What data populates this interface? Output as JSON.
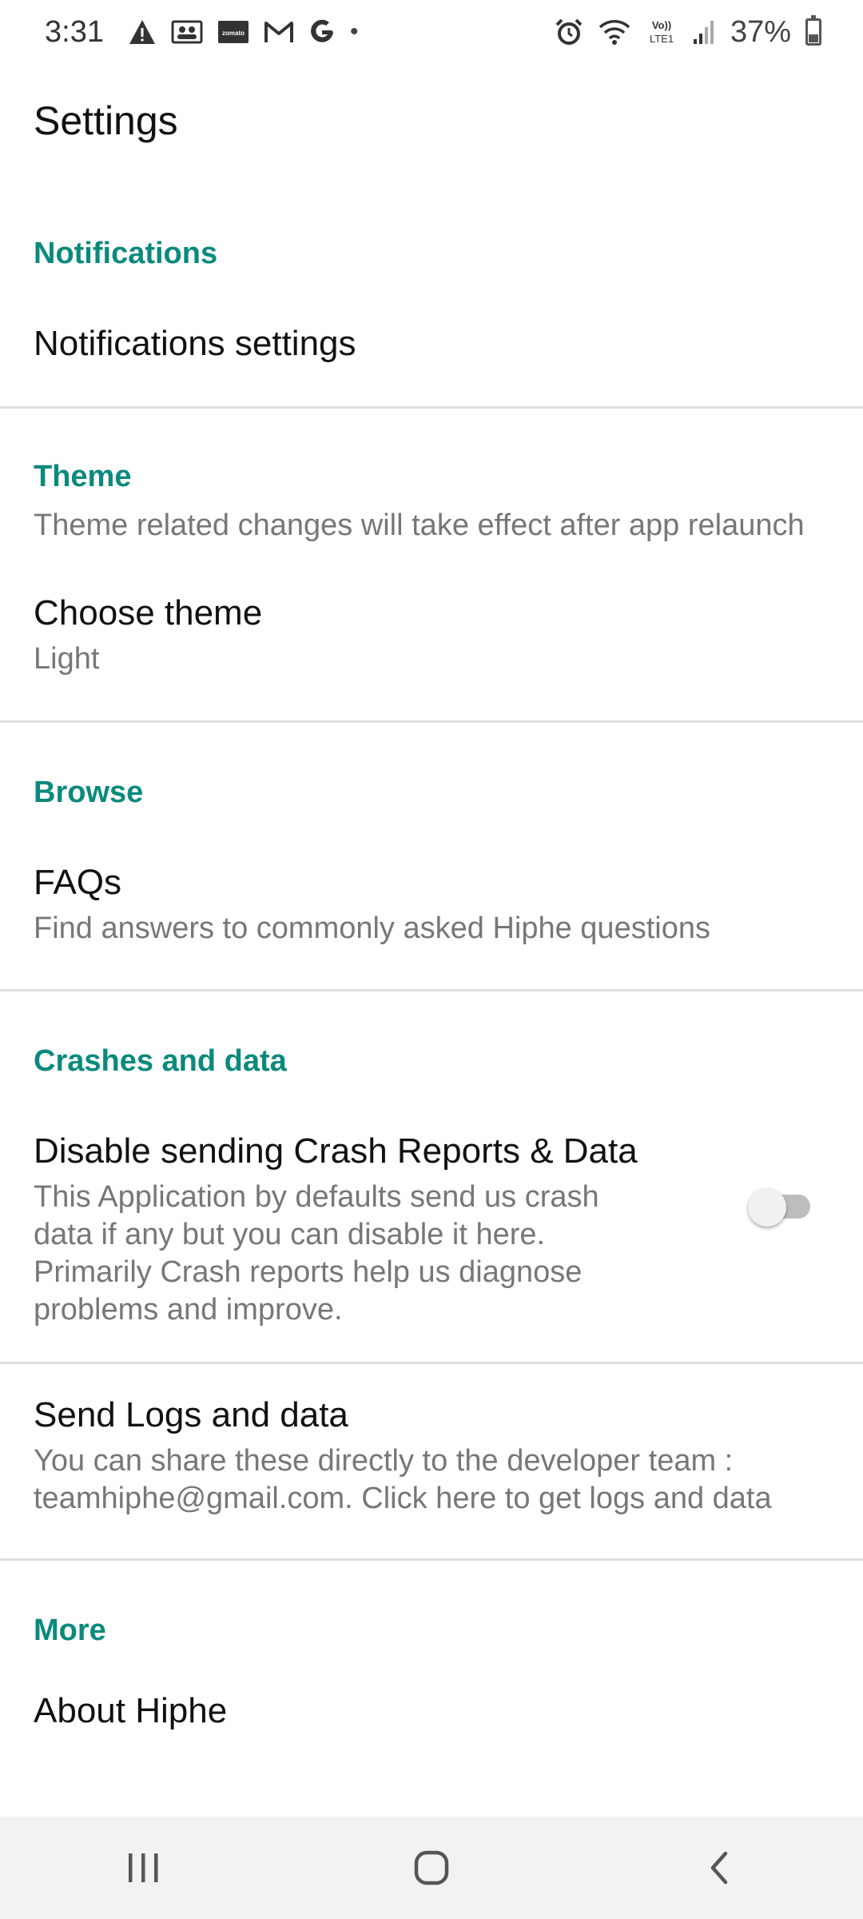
{
  "status_bar": {
    "time": "3:31",
    "battery_percent": "37%",
    "battery_level": 0.37,
    "left_icons": [
      "warning-icon",
      "contacts-icon",
      "zomato-icon",
      "gmail-icon",
      "google-icon",
      "more-dot"
    ],
    "right_icons": [
      "alarm-icon",
      "wifi-icon",
      "volte-icon",
      "signal-icon",
      "battery-icon"
    ],
    "volte_label": "Vo))\nLTE1",
    "zomato_label": "zomato"
  },
  "toolbar": {
    "title": "Settings"
  },
  "sections": {
    "notifications": {
      "header": "Notifications",
      "items": [
        {
          "title": "Notifications settings"
        }
      ]
    },
    "theme": {
      "header": "Theme",
      "header_summary": "Theme related changes will take effect after app relaunch",
      "items": [
        {
          "title": "Choose theme",
          "summary": "Light"
        }
      ]
    },
    "browse": {
      "header": "Browse",
      "items": [
        {
          "title": "FAQs",
          "summary": "Find answers to commonly asked Hiphe questions"
        }
      ]
    },
    "crashes": {
      "header": "Crashes and data",
      "items": [
        {
          "title": "Disable sending Crash Reports & Data",
          "summary": "This Application by defaults send us crash data if any but you can disable it here. Primarily Crash reports help us diagnose problems and improve.",
          "toggle_on": false
        },
        {
          "title": "Send Logs and data",
          "summary": "You can share these directly to the developer team : teamhiphe@gmail.com. Click here to get logs and data"
        }
      ]
    },
    "more": {
      "header": "More",
      "items": [
        {
          "title": "About Hiphe"
        }
      ]
    }
  },
  "colors": {
    "accent": "#0a8a7c",
    "divider": "#dedede",
    "navbar_bg": "#f2f2f2"
  },
  "nav_bar": {
    "buttons": [
      "recents-icon",
      "home-icon",
      "back-icon"
    ]
  }
}
